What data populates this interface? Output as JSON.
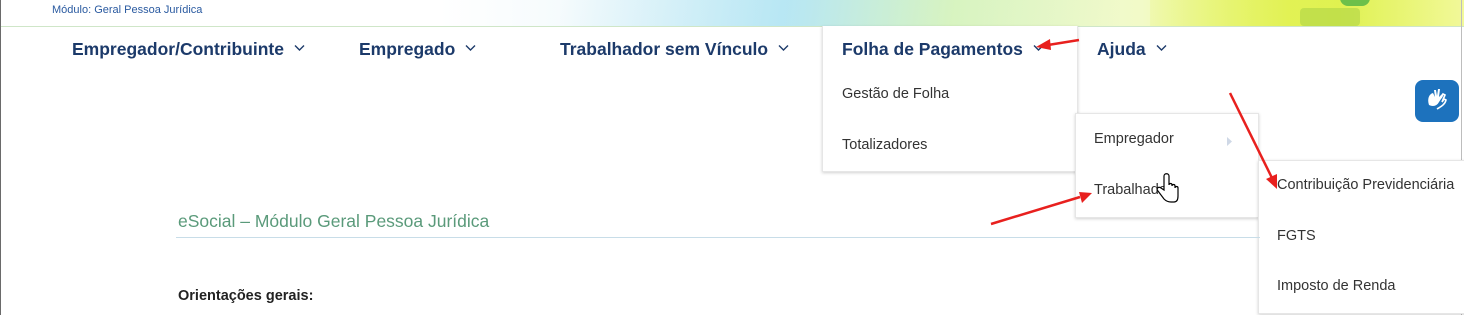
{
  "header": {
    "module_label": "Módulo: Geral Pessoa Jurídica"
  },
  "nav": {
    "items": [
      {
        "label": "Empregador/Contribuinte",
        "icon": "chevron-down-icon"
      },
      {
        "label": "Empregado",
        "icon": "chevron-down-icon"
      },
      {
        "label": "Trabalhador sem Vínculo",
        "icon": "chevron-down-icon"
      },
      {
        "label": "Folha de Pagamentos",
        "icon": "chevron-down-icon"
      },
      {
        "label": "Ajuda",
        "icon": "chevron-down-icon"
      }
    ]
  },
  "folha_menu": {
    "items": [
      "Gestão de Folha",
      "Totalizadores"
    ]
  },
  "totalizadores_submenu": {
    "items": [
      "Empregador",
      "Trabalhador"
    ]
  },
  "trabalhador_submenu": {
    "items": [
      "Contribuição Previdenciária",
      "FGTS",
      "Imposto de Renda"
    ]
  },
  "accessibility": {
    "icon": "sign-language-hands-icon",
    "color": "#1d72bd"
  },
  "content": {
    "title": "eSocial – Módulo Geral Pessoa Jurídica",
    "heading": "Orientações gerais:"
  },
  "annotations": {
    "arrow_color": "#e8201e"
  },
  "colors": {
    "nav_text": "#1c3a6a",
    "title_green": "#5a9a7a"
  }
}
